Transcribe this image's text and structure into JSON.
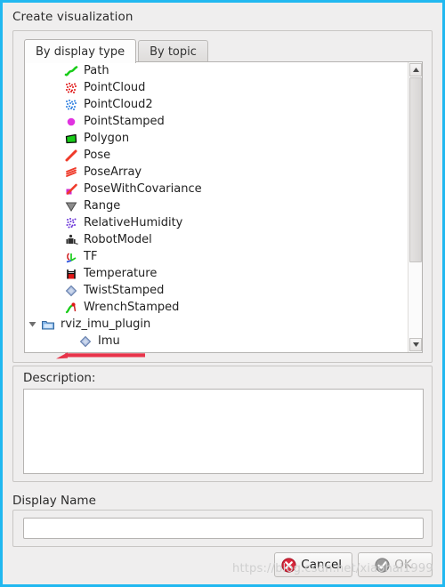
{
  "dialog": {
    "title": "Create visualization",
    "outer_border_color": "#21b8f0"
  },
  "tabs": [
    {
      "label": "By display type",
      "active": true
    },
    {
      "label": "By topic",
      "active": false
    }
  ],
  "tree": {
    "items": [
      {
        "label": "Path",
        "icon": "path-icon",
        "depth": 1
      },
      {
        "label": "PointCloud",
        "icon": "pointcloud-icon",
        "depth": 1
      },
      {
        "label": "PointCloud2",
        "icon": "pointcloud2-icon",
        "depth": 1
      },
      {
        "label": "PointStamped",
        "icon": "pointstamped-icon",
        "depth": 1
      },
      {
        "label": "Polygon",
        "icon": "polygon-icon",
        "depth": 1
      },
      {
        "label": "Pose",
        "icon": "pose-icon",
        "depth": 1
      },
      {
        "label": "PoseArray",
        "icon": "posearray-icon",
        "depth": 1
      },
      {
        "label": "PoseWithCovariance",
        "icon": "posewithcovariance-icon",
        "depth": 1
      },
      {
        "label": "Range",
        "icon": "range-icon",
        "depth": 1
      },
      {
        "label": "RelativeHumidity",
        "icon": "relativehumidity-icon",
        "depth": 1
      },
      {
        "label": "RobotModel",
        "icon": "robotmodel-icon",
        "depth": 1
      },
      {
        "label": "TF",
        "icon": "tf-icon",
        "depth": 1
      },
      {
        "label": "Temperature",
        "icon": "temperature-icon",
        "depth": 1
      },
      {
        "label": "TwistStamped",
        "icon": "twiststamped-icon",
        "depth": 1
      },
      {
        "label": "WrenchStamped",
        "icon": "wrenchstamped-icon",
        "depth": 1
      },
      {
        "label": "rviz_imu_plugin",
        "icon": "folder-icon",
        "depth": 0,
        "expander": "expanded"
      },
      {
        "label": "Imu",
        "icon": "imu-icon",
        "depth": 2
      }
    ]
  },
  "scrollbar": {
    "up_arrow": "▲",
    "down_arrow": "▼"
  },
  "description": {
    "label": "Description:",
    "value": ""
  },
  "display_name": {
    "label": "Display Name",
    "value": "",
    "placeholder": ""
  },
  "buttons": {
    "cancel": {
      "label": "Cancel",
      "icon": "cancel-icon",
      "enabled": true
    },
    "ok": {
      "label": "OK",
      "icon": "ok-icon",
      "enabled": false
    }
  },
  "watermark": {
    "text": "https://blog.csdn.net/xiaohai1999"
  },
  "annotation": {
    "color": "#e8344a"
  }
}
